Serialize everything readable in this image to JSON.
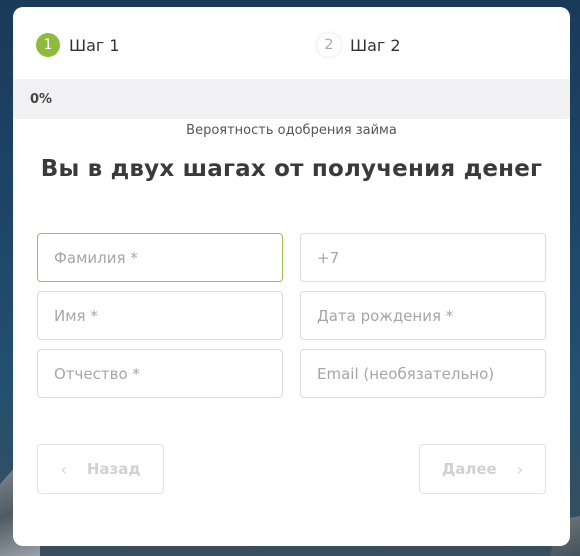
{
  "steps": [
    {
      "number": "1",
      "label": "Шаг 1"
    },
    {
      "number": "2",
      "label": "Шаг 2"
    }
  ],
  "progress": {
    "text": "0%",
    "value": 0
  },
  "approval_label": "Вероятность одобрения займа",
  "title": "Вы в двух шагах от получения денег",
  "fields": {
    "last_name": {
      "placeholder": "Фамилия *"
    },
    "phone": {
      "placeholder": "+7"
    },
    "first_name": {
      "placeholder": "Имя *"
    },
    "birth_date": {
      "placeholder": "Дата рождения *"
    },
    "patronymic": {
      "placeholder": "Отчество *"
    },
    "email": {
      "placeholder": "Email (необязательно)"
    }
  },
  "buttons": {
    "back": "Назад",
    "next": "Далее"
  },
  "icons": {
    "back": "chevron-left-icon",
    "next": "chevron-right-icon"
  },
  "colors": {
    "accent": "#8fbb3c",
    "active_border": "#9ec24a"
  }
}
